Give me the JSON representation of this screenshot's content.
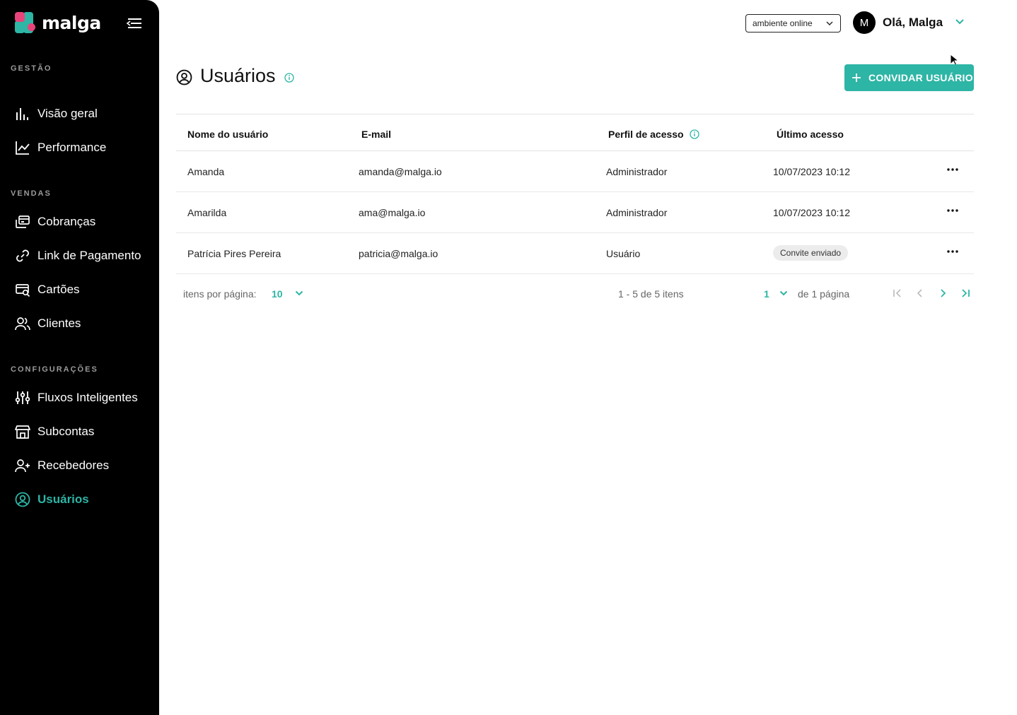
{
  "brand": {
    "name": "malga",
    "colors": {
      "primary": "#2db5a5",
      "pink": "#e8447a"
    }
  },
  "sidebar": {
    "sections": [
      {
        "label": "GESTÃO"
      },
      {
        "label": "VENDAS"
      },
      {
        "label": "CONFIGURAÇÕES"
      }
    ],
    "items": [
      {
        "label": "Visão geral",
        "icon": "bar-chart-icon"
      },
      {
        "label": "Performance",
        "icon": "line-chart-icon"
      },
      {
        "label": "Cobranças",
        "icon": "charges-icon"
      },
      {
        "label": "Link de Pagamento",
        "icon": "link-icon"
      },
      {
        "label": "Cartões",
        "icon": "card-search-icon"
      },
      {
        "label": "Clientes",
        "icon": "users-icon"
      },
      {
        "label": "Fluxos Inteligentes",
        "icon": "sliders-icon"
      },
      {
        "label": "Subcontas",
        "icon": "store-icon"
      },
      {
        "label": "Recebedores",
        "icon": "user-plus-icon"
      },
      {
        "label": "Usuários",
        "icon": "user-circle-icon",
        "active": true
      }
    ]
  },
  "header": {
    "environment": "ambiente online",
    "avatar_initial": "M",
    "greeting": "Olá, Malga"
  },
  "page": {
    "title": "Usuários",
    "invite_button": "CONVIDAR USUÁRIO"
  },
  "table": {
    "columns": [
      "Nome do usuário",
      "E-mail",
      "Perfil de acesso",
      "Último acesso"
    ],
    "rows": [
      {
        "name": "Amanda",
        "email": "amanda@malga.io",
        "profile": "Administrador",
        "last_access": "10/07/2023 10:12"
      },
      {
        "name": "Amarilda",
        "email": "ama@malga.io",
        "profile": "Administrador",
        "last_access": "10/07/2023 10:12"
      },
      {
        "name": "Patrícia Pires Pereira",
        "email": "patricia@malga.io",
        "profile": "Usuário",
        "last_access": "Convite enviado"
      }
    ]
  },
  "pagination": {
    "per_page_label": "itens por página:",
    "per_page": "10",
    "range": "1 - 5 de 5 itens",
    "page": "1",
    "of_pages": "de 1 página"
  }
}
